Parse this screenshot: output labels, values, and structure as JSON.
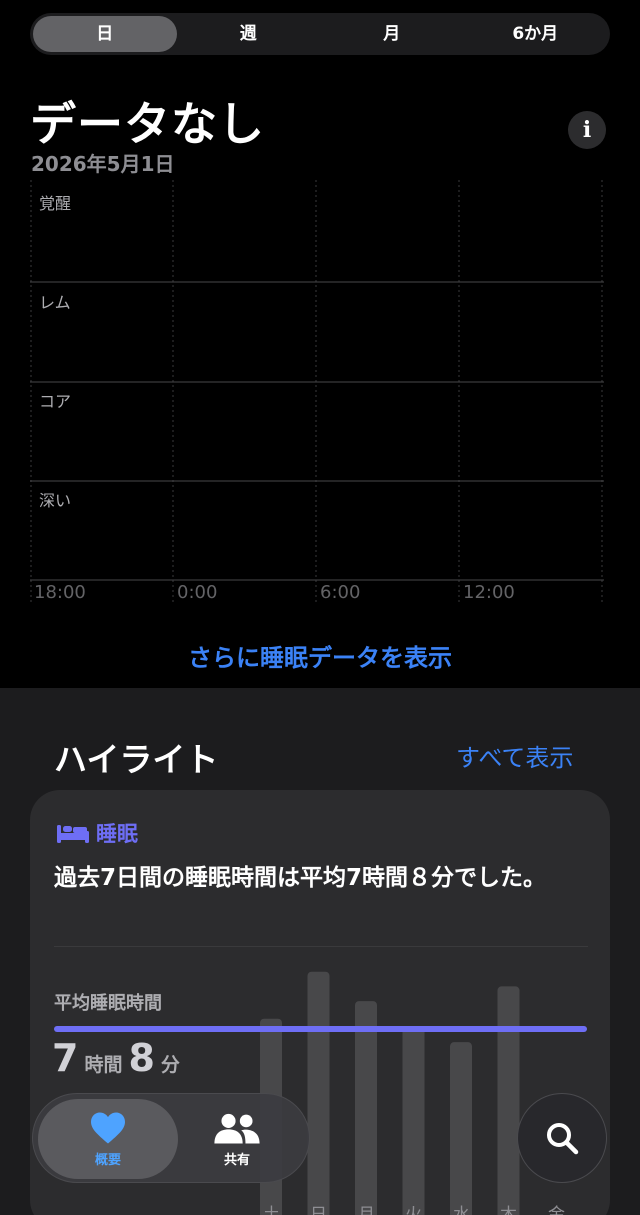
{
  "segments": [
    "日",
    "週",
    "月",
    "6か月"
  ],
  "selected_segment": "日",
  "headline": "データなし",
  "date": "2026年5月1日",
  "chart_data": {
    "type": "bar",
    "categories": [
      "覚醒",
      "レム",
      "コア",
      "深い"
    ],
    "x_ticks": [
      "18:00",
      "0:00",
      "6:00",
      "12:00"
    ],
    "values": [],
    "grid": true
  },
  "more_link": "さらに睡眠データを表示",
  "highlights": {
    "title": "ハイライト",
    "show_all": "すべて表示",
    "card": {
      "tag": "睡眠",
      "summary": "過去7日間の睡眠時間は平均7時間８分でした。",
      "avg_label": "平均睡眠時間",
      "avg_hours": "7",
      "hours_unit": "時間",
      "avg_minutes": "8",
      "minutes_unit": "分",
      "chart_data": {
        "type": "bar",
        "categories": [
          "土",
          "日",
          "月",
          "火",
          "水",
          "木",
          "金"
        ],
        "values": [
          7.2,
          8.8,
          7.8,
          6.9,
          6.4,
          8.3,
          null
        ],
        "average": 7.13
      }
    }
  },
  "tabbar": {
    "summary_label": "概要",
    "sharing_label": "共有"
  },
  "colors": {
    "accent_blue": "#3b82f6",
    "sleep_purple": "#6e6ef5",
    "background": "#000000",
    "panel": "#1c1c1e",
    "card": "#2c2c2e"
  }
}
